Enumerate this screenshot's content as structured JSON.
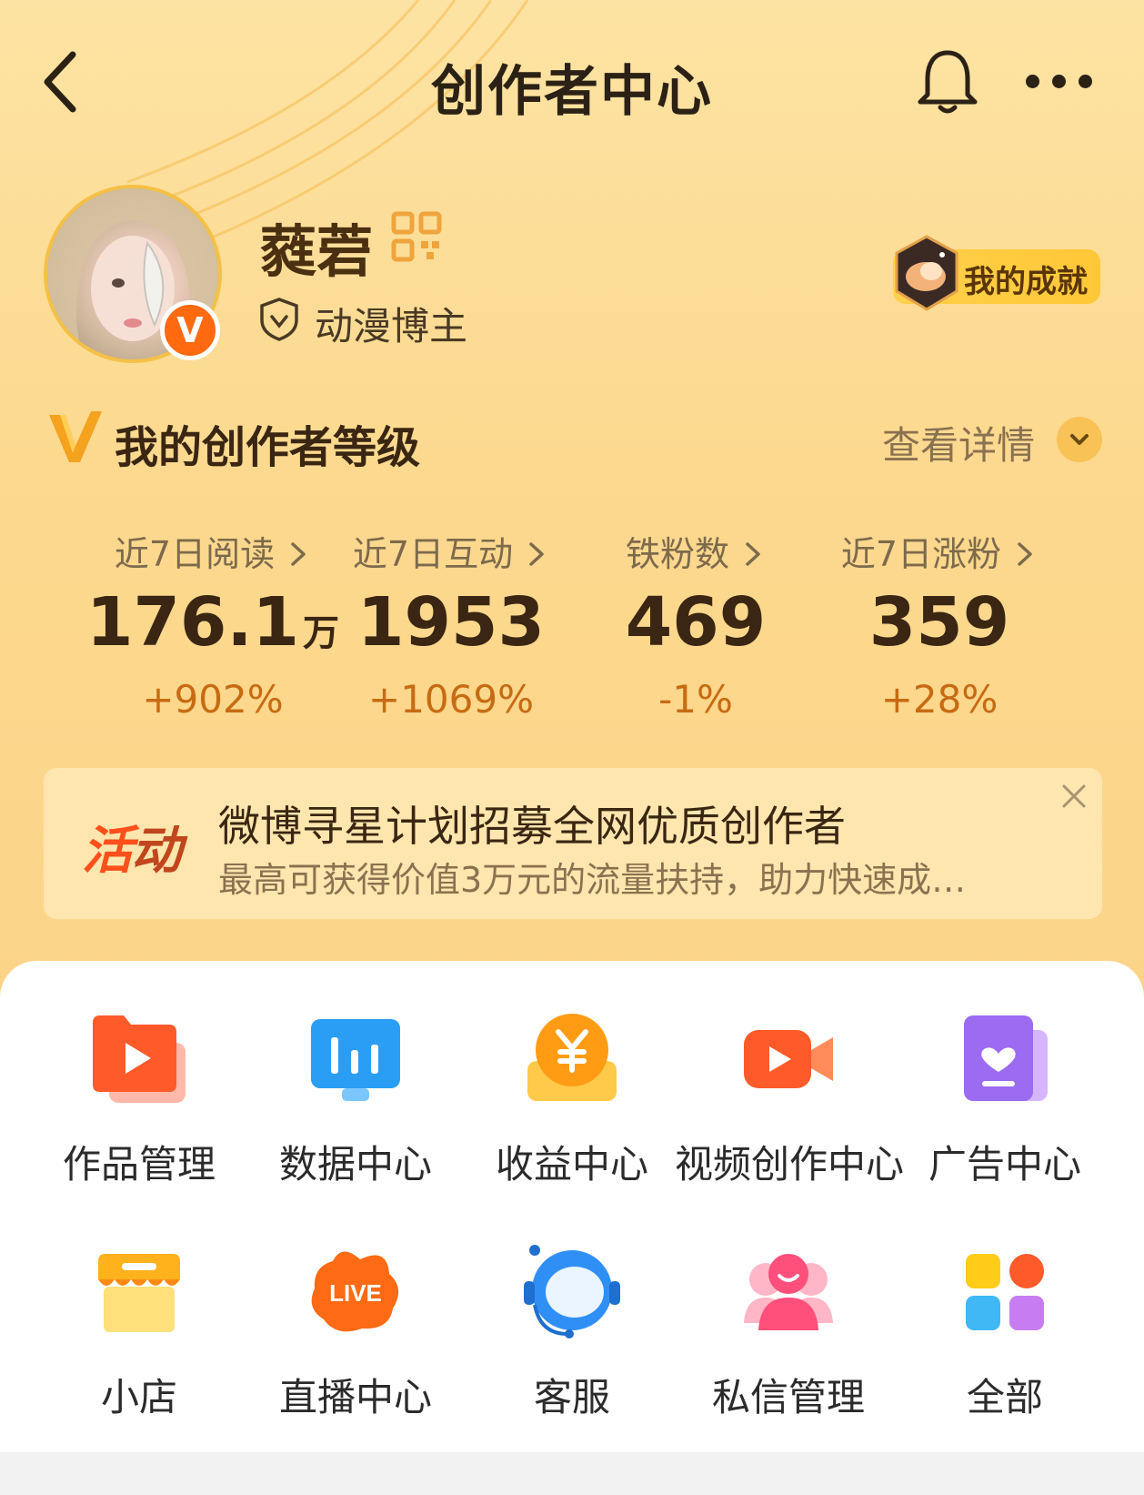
{
  "header": {
    "title": "创作者中心",
    "back_icon": "back-chevron-icon",
    "bell_icon": "bell-icon",
    "more_icon": "more-dots-icon"
  },
  "profile": {
    "username": "蕤菪",
    "verified_badge": "V",
    "tag": "动漫博主",
    "achievement_label": "我的成就"
  },
  "level": {
    "title": "我的创作者等级",
    "detail_label": "查看详情"
  },
  "stats": [
    {
      "label": "近7日阅读",
      "value": "176.1",
      "unit": "万",
      "change": "+902%"
    },
    {
      "label": "近7日互动",
      "value": "1953",
      "unit": "",
      "change": "+1069%"
    },
    {
      "label": "铁粉数",
      "value": "469",
      "unit": "",
      "change": "-1%"
    },
    {
      "label": "近7日涨粉",
      "value": "359",
      "unit": "",
      "change": "+28%"
    }
  ],
  "activity": {
    "tag_a": "活",
    "tag_b": "动",
    "title": "微博寻星计划招募全网优质创作者",
    "subtitle": "最高可获得价值3万元的流量扶持，助力快速成…"
  },
  "tools": [
    {
      "label": "作品管理",
      "icon": "works-play-icon"
    },
    {
      "label": "数据中心",
      "icon": "data-chart-icon"
    },
    {
      "label": "收益中心",
      "icon": "yuan-coin-icon"
    },
    {
      "label": "视频创作中心",
      "icon": "video-camera-icon"
    },
    {
      "label": "广告中心",
      "icon": "ad-heart-icon"
    },
    {
      "label": "小店",
      "icon": "shop-icon"
    },
    {
      "label": "直播中心",
      "icon": "live-icon"
    },
    {
      "label": "客服",
      "icon": "customer-service-icon"
    },
    {
      "label": "私信管理",
      "icon": "private-message-icon"
    },
    {
      "label": "全部",
      "icon": "all-apps-icon"
    }
  ],
  "colors": {
    "hero_bg": "#fcd98f",
    "accent_orange": "#ff6a10",
    "change_text": "#c76b12"
  }
}
